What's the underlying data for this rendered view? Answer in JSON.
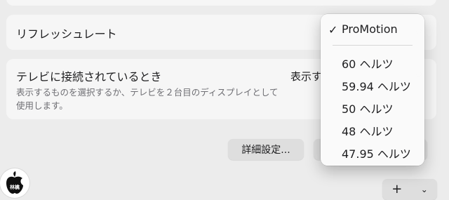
{
  "refresh_rate": {
    "label": "リフレッシュレート"
  },
  "tv_connection": {
    "label": "テレビに接続されているとき",
    "description": "表示するものを選択するか、テレビを２台目のディスプレイとして使用します。",
    "value": "表示す"
  },
  "buttons": {
    "advanced": "詳細設定...",
    "add": "+",
    "add_menu": "⌄"
  },
  "menu": {
    "checkmark": "✓",
    "items": [
      {
        "label": "ProMotion",
        "selected": true
      },
      {
        "label": "60 ヘルツ",
        "selected": false
      },
      {
        "label": "59.94 ヘルツ",
        "selected": false
      },
      {
        "label": "50 ヘルツ",
        "selected": false
      },
      {
        "label": "48 ヘルツ",
        "selected": false
      },
      {
        "label": "47.95 ヘルツ",
        "selected": false
      }
    ]
  },
  "logo": {
    "text": "林檎"
  },
  "colors": {
    "background": "#ececec",
    "card": "#f6f6f6",
    "text": "#1d1d1f",
    "secondary_text": "#6e6e73",
    "button": "#dedede"
  }
}
